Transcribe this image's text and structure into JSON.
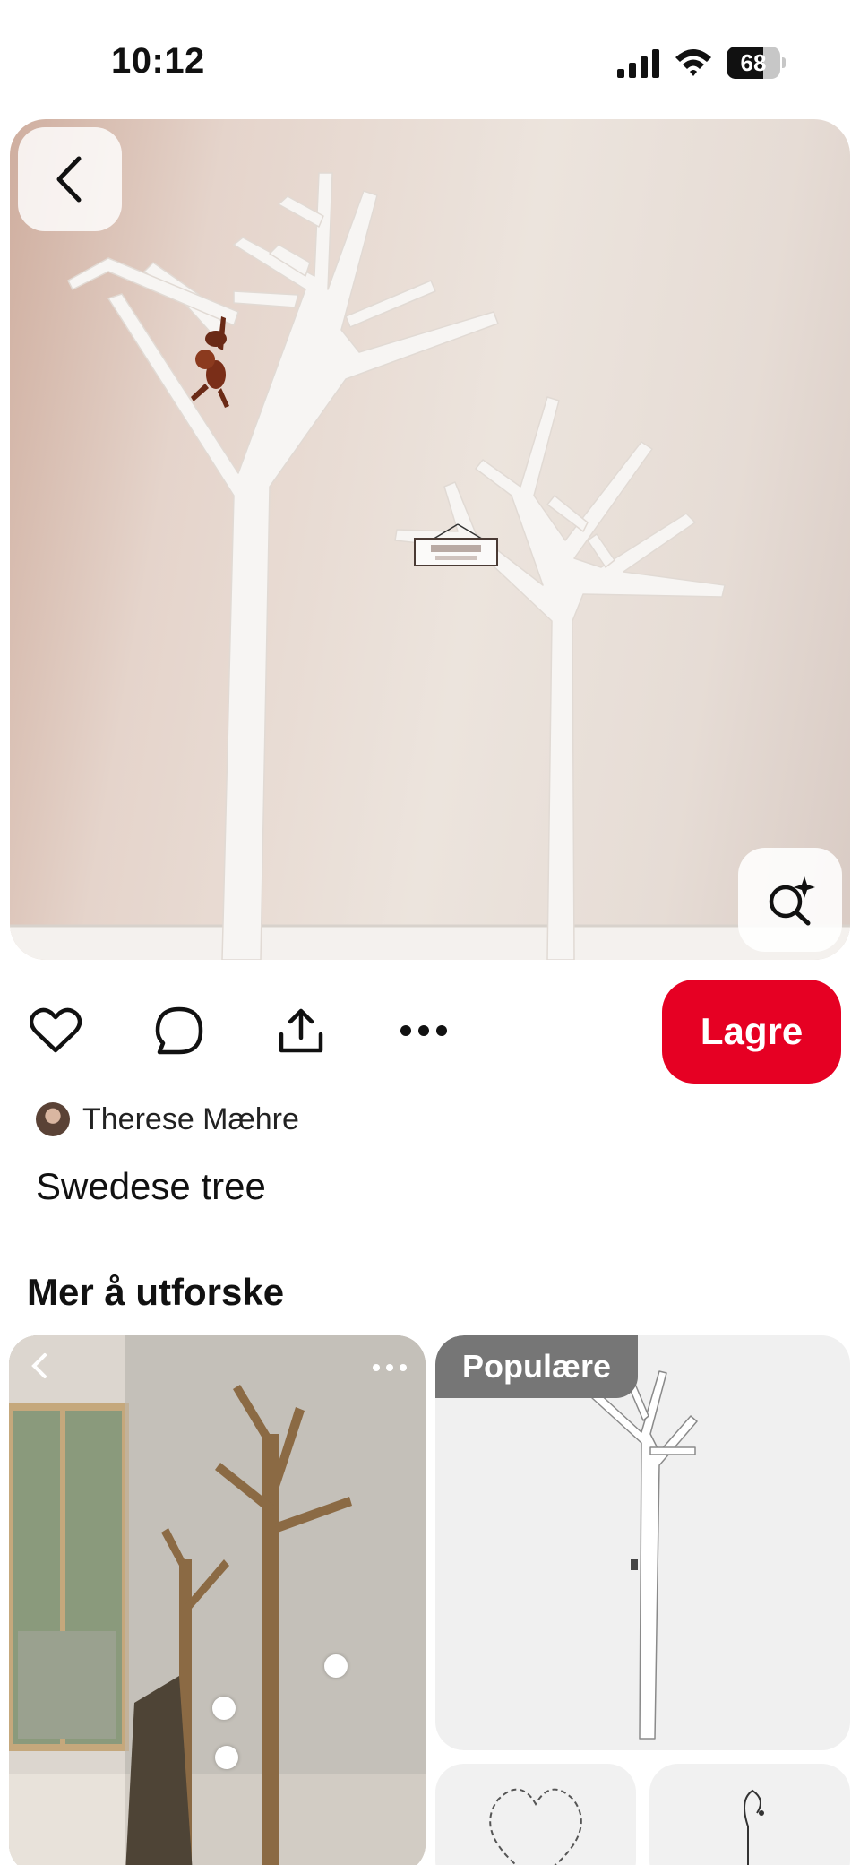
{
  "status_bar": {
    "time": "10:12",
    "battery": "68",
    "battery_level": 0.68
  },
  "hero": {
    "icons": {
      "back": "chevron-left-icon",
      "lens": "visual-search-sparkle-icon"
    }
  },
  "actions": {
    "icons": [
      "heart-icon",
      "comment-icon",
      "share-icon",
      "more-icon"
    ],
    "save_label": "Lagre",
    "save_color": "#e60023"
  },
  "pin": {
    "author": "Therese Mæhre",
    "title": "Swedese tree"
  },
  "explore": {
    "title": "Mer å utforske",
    "badge": "Populære"
  }
}
